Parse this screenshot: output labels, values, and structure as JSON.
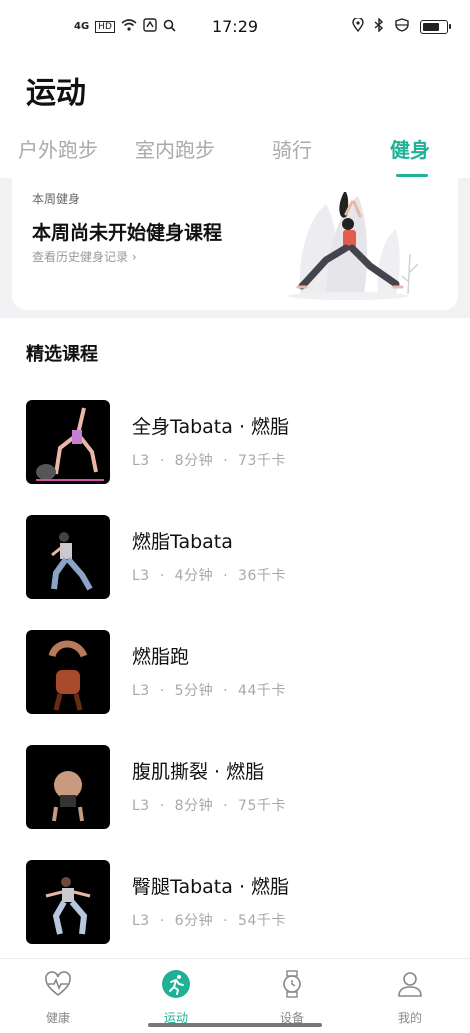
{
  "status_bar": {
    "time": "17:29",
    "left_icons": [
      "signal-icon",
      "volte-icon",
      "wifi-icon",
      "data-icon",
      "search-icon"
    ],
    "right_icons": [
      "location-icon",
      "bluetooth-icon",
      "vpn-icon",
      "battery-icon"
    ],
    "signal_text": "4G",
    "volte_text": "HD"
  },
  "header": {
    "title": "运动",
    "tabs": [
      {
        "label": "户外跑步",
        "active": false
      },
      {
        "label": "室内跑步",
        "active": false
      },
      {
        "label": "骑行",
        "active": false
      },
      {
        "label": "健身",
        "active": true
      }
    ]
  },
  "week_card": {
    "label": "本周健身",
    "title": "本周尚未开始健身课程",
    "link": "查看历史健身记录 ›"
  },
  "featured": {
    "section_title": "精选课程",
    "courses": [
      {
        "name": "全身Tabata · 燃脂",
        "level": "L3",
        "duration": "8分钟",
        "calories": "73千卡"
      },
      {
        "name": "燃脂Tabata",
        "level": "L3",
        "duration": "4分钟",
        "calories": "36千卡"
      },
      {
        "name": "燃脂跑",
        "level": "L3",
        "duration": "5分钟",
        "calories": "44千卡"
      },
      {
        "name": "腹肌撕裂 · 燃脂",
        "level": "L3",
        "duration": "8分钟",
        "calories": "75千卡"
      },
      {
        "name": "臀腿Tabata · 燃脂",
        "level": "L3",
        "duration": "6分钟",
        "calories": "54千卡"
      }
    ],
    "separator": "·"
  },
  "bottom_nav": [
    {
      "label": "健康",
      "icon": "heart-pulse-icon",
      "active": false
    },
    {
      "label": "运动",
      "icon": "running-icon",
      "active": true
    },
    {
      "label": "设备",
      "icon": "watch-icon",
      "active": false
    },
    {
      "label": "我的",
      "icon": "profile-icon",
      "active": false
    }
  ],
  "colors": {
    "accent": "#1fb196",
    "muted": "#a8a8a8"
  }
}
